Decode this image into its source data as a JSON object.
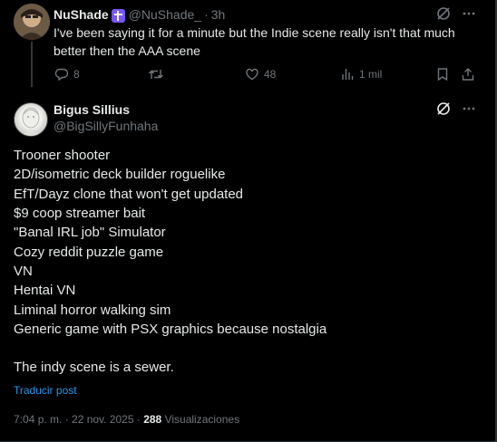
{
  "parent_tweet": {
    "author_name": "NuShade",
    "author_handle": "@NuShade_",
    "separator": "·",
    "time": "3h",
    "text": "I've been saying it for a minute but the Indie scene really isn't that much better then the AAA scene",
    "replies": "8",
    "retweets": "",
    "likes": "48",
    "views": "1 mil"
  },
  "main_tweet": {
    "author_name": "Bigus Sillius",
    "author_handle": "@BigSillyFunhaha",
    "lines": [
      "Trooner shooter",
      "2D/isometric deck builder roguelike",
      "EfT/Dayz clone that won't get updated",
      "$9 coop streamer bait",
      "\"Banal IRL job\" Simulator",
      "Cozy reddit puzzle game",
      "VN",
      "Hentai VN",
      "Liminal horror walking sim",
      "Generic game with PSX graphics because nostalgia"
    ],
    "closing_line": "The indy scene is a sewer.",
    "translate_label": "Traducir post",
    "timestamp": "7:04 p. m. · 22 nov. 2025 ·",
    "view_count": "288",
    "views_label": "Visualizaciones"
  },
  "colors": {
    "background": "#000000",
    "text": "#e7e9ea",
    "muted": "#71767b",
    "link": "#1d9bf0",
    "badge": "#7856ff"
  },
  "icons": [
    "cross-badge-icon",
    "grok-icon",
    "more-icon",
    "reply-icon",
    "retweet-icon",
    "like-icon",
    "views-icon",
    "bookmark-icon",
    "share-icon"
  ]
}
